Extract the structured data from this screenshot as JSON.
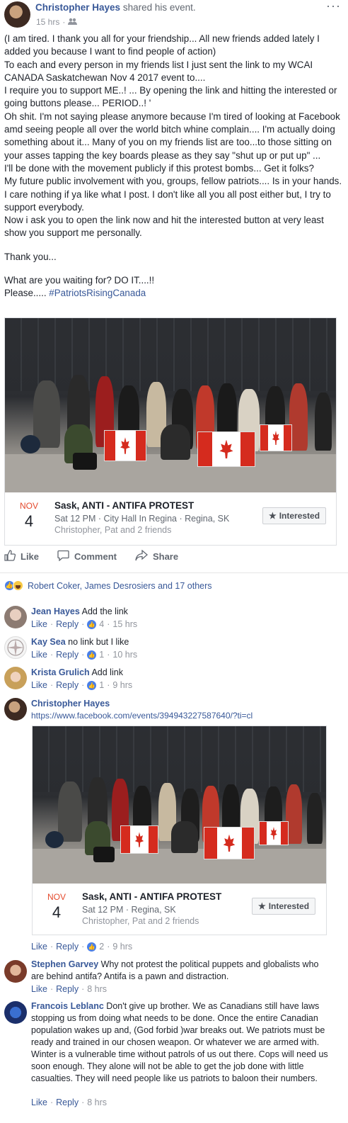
{
  "post": {
    "author": "Christopher Hayes",
    "action": "shared his event.",
    "time": "15 hrs",
    "dot": "·",
    "more": "···",
    "paragraphs": [
      "(I am tired. I thank you all for your friendship... All new friends added lately I added you because I want to find people of action)",
      "To each and every person in my friends list I just sent the link to my WCAI CANADA Saskatchewan Nov 4 2017 event to....",
      "I require you to support ME..! ... By opening the link and hitting the interested or going buttons please... PERIOD..! '",
      "Oh shit. I'm not saying please anymore because I'm tired of looking at Facebook amd seeing people all over the world bitch whine complain.... I'm actually doing something about it... Many of you on my friends list are too...to those sitting on your asses tapping the key boards please as they say \"shut up or put up\" ...",
      "I'll be done with the movement publicly if this protest bombs... Get it folks?",
      "My future public involvement with you, groups, fellow patriots.... Is in your hands. I care nothing if ya like what I post. I don't like all you all post either but, I try to support everybody.",
      "Now i ask you to open the link now and hit the interested button at very least show you support me personally."
    ],
    "thanks": "Thank you...",
    "waiting": "What are you waiting for? DO IT....!!",
    "please_prefix": "Please..... ",
    "hashtag": "#PatriotsRisingCanada"
  },
  "event1": {
    "month": "NOV",
    "day": "4",
    "title": "Sask, ANTI - ANTIFA PROTEST",
    "sub": "Sat 12 PM · City Hall In Regina · Regina, SK",
    "friends": "Christopher, Pat and 2 friends",
    "button": "Interested",
    "star": "★"
  },
  "actions": {
    "like": "Like",
    "comment": "Comment",
    "share": "Share"
  },
  "reactions": {
    "names": "Robert Coker, James Desrosiers and 17 others"
  },
  "comments": [
    {
      "author": "Jean Hayes",
      "text": "Add the link",
      "like": "Like",
      "reply": "Reply",
      "likes": "4",
      "time": "15 hrs"
    },
    {
      "author": "Kay Sea",
      "text": "no link but I like",
      "like": "Like",
      "reply": "Reply",
      "likes": "1",
      "time": "10 hrs"
    },
    {
      "author": "Krista Grulich",
      "text": "Add link",
      "like": "Like",
      "reply": "Reply",
      "likes": "1",
      "time": "9 hrs"
    },
    {
      "author": "Christopher Hayes",
      "url": "https://www.facebook.com/events/394943227587640/?ti=cl",
      "like": "Like",
      "reply": "Reply",
      "likes": "2",
      "time": "9 hrs"
    },
    {
      "author": "Stephen Garvey",
      "text": "Why not protest the political puppets and globalists who are behind antifa? Antifa is a pawn and distraction.",
      "like": "Like",
      "reply": "Reply",
      "time": "8 hrs"
    },
    {
      "author": "Francois Leblanc",
      "text": "Don't give up brother. We as Canadians still have laws stopping us from doing what needs to be done. Once the entire Canadian population wakes up and, (God forbid )war breaks out. We patriots must be ready and trained in our chosen weapon. Or whatever we are armed with. Winter is a vulnerable time without patrols of us out there. Cops will need us soon enough. They alone will not be able to get the job done with little casualties. They will need people like us patriots to baloon their numbers.",
      "like": "Like",
      "reply": "Reply",
      "time": "8 hrs"
    }
  ],
  "event2": {
    "month": "NOV",
    "day": "4",
    "title": "Sask, ANTI - ANTIFA PROTEST",
    "sub": "Sat 12 PM · Regina, SK",
    "friends": "Christopher, Pat and 2 friends",
    "button": "Interested",
    "star": "★"
  },
  "sep": "·",
  "colors": {
    "link": "#385898",
    "accent_red": "#e4492c",
    "like_blue": "#4a7fe8"
  }
}
